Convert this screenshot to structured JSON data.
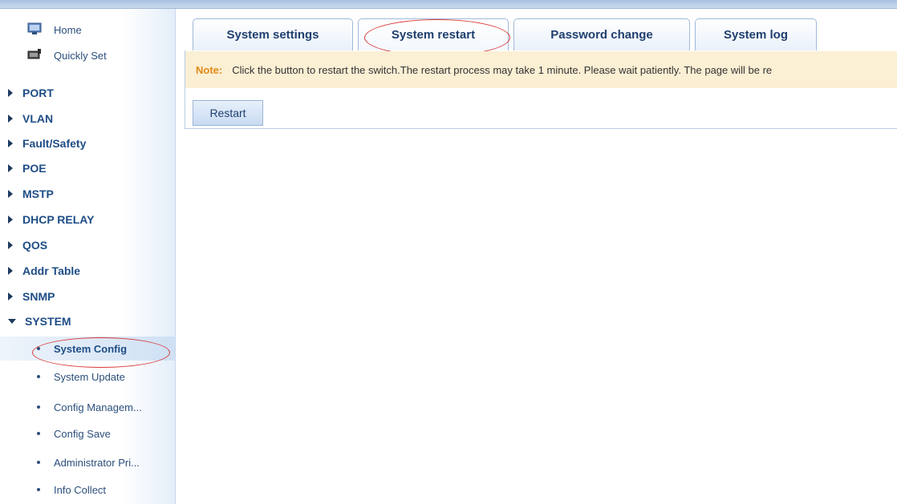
{
  "sidebar": {
    "top_items": [
      {
        "label": "Home",
        "icon": "home-icon"
      },
      {
        "label": "Quickly Set",
        "icon": "quick-set-icon"
      }
    ],
    "groups": [
      {
        "label": "PORT"
      },
      {
        "label": "VLAN"
      },
      {
        "label": "Fault/Safety"
      },
      {
        "label": "POE"
      },
      {
        "label": "MSTP"
      },
      {
        "label": "DHCP RELAY"
      },
      {
        "label": "QOS"
      },
      {
        "label": "Addr Table"
      },
      {
        "label": "SNMP"
      },
      {
        "label": "SYSTEM",
        "expanded": true
      }
    ],
    "system_sub_items": [
      {
        "label": "System Config",
        "active": true
      },
      {
        "label": "System Update"
      },
      {
        "label": "Config Managem..."
      },
      {
        "label": "Config Save"
      },
      {
        "label": "Administrator Pri..."
      },
      {
        "label": "Info Collect"
      }
    ]
  },
  "tabs": [
    {
      "label": "System settings"
    },
    {
      "label": "System restart",
      "active": true
    },
    {
      "label": "Password change"
    },
    {
      "label": "System log"
    }
  ],
  "note": {
    "label": "Note:",
    "text": "Click the button to restart the switch.The restart process may take 1 minute. Please wait patiently. The page will be re"
  },
  "restart_button": {
    "label": "Restart"
  },
  "colors": {
    "accent": "#1e4d86",
    "note_bg": "#fbefd4",
    "note_label": "#e08a17",
    "highlight_oval": "#d93a3a"
  }
}
